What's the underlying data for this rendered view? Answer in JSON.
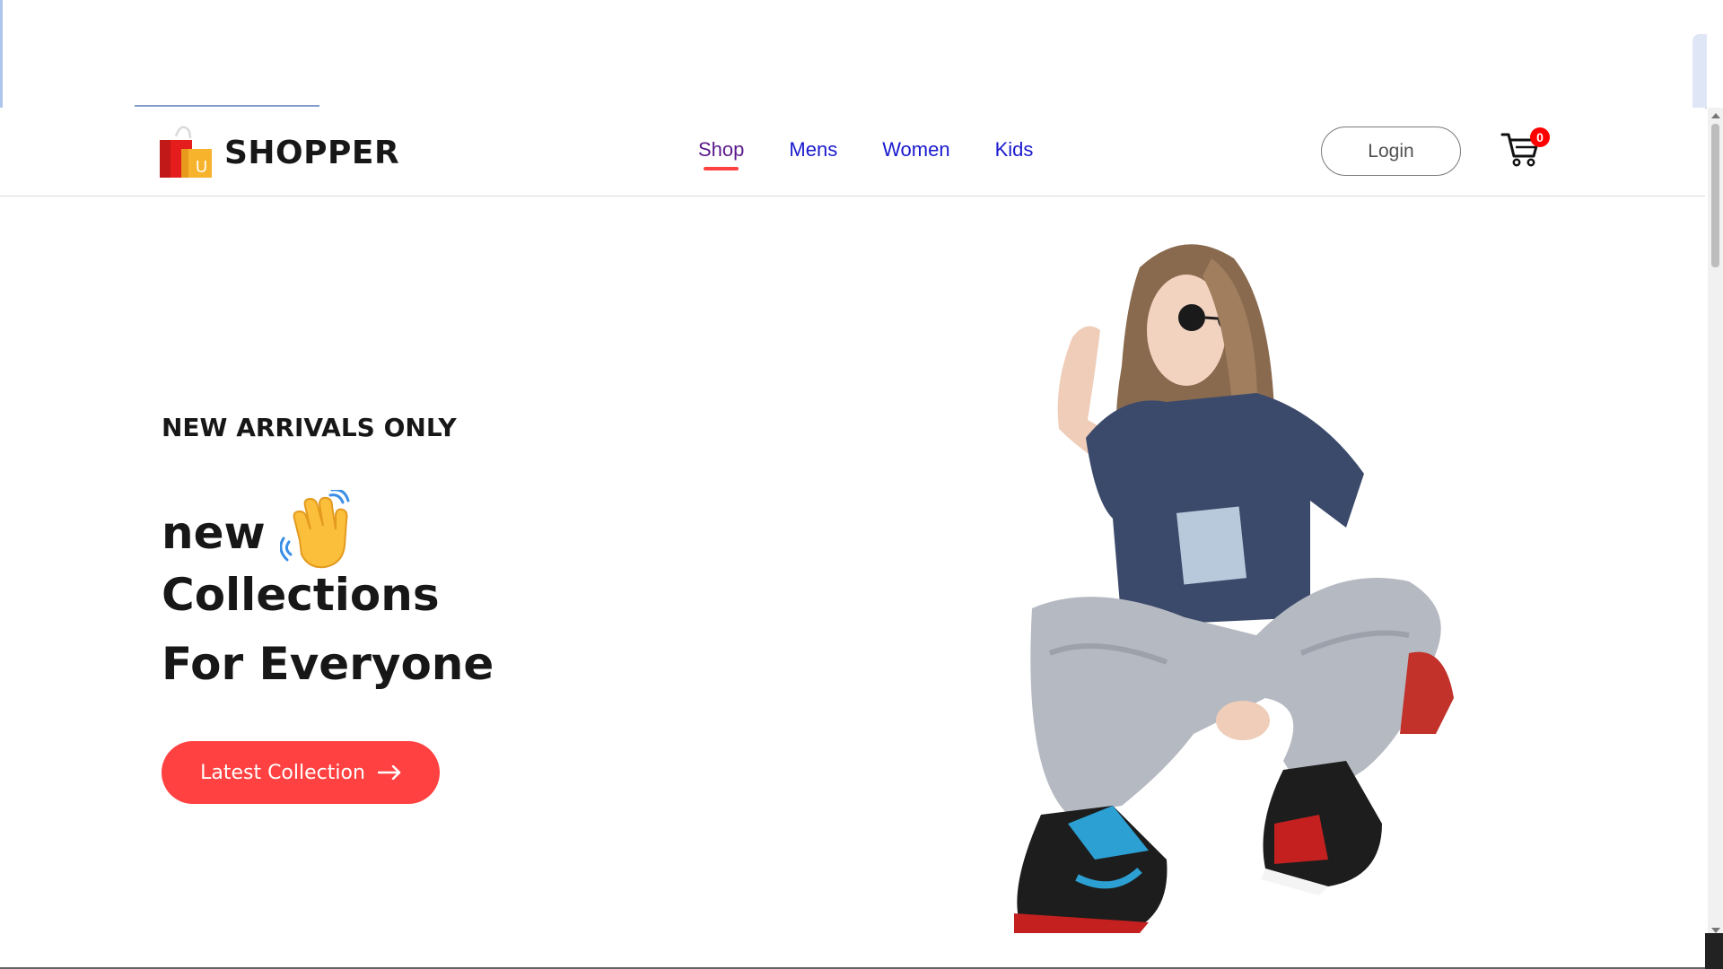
{
  "navbar": {
    "logo_text": "SHOPPER",
    "logo_badge": "U",
    "menu": [
      {
        "label": "Shop",
        "active": true
      },
      {
        "label": "Mens",
        "active": false
      },
      {
        "label": "Women",
        "active": false
      },
      {
        "label": "Kids",
        "active": false
      }
    ],
    "login_label": "Login",
    "cart_count": "0",
    "icons": {
      "logo": "shopping-bag-icon",
      "cart": "cart-icon"
    }
  },
  "hero": {
    "kicker": "NEW ARRIVALS ONLY",
    "line1": "new",
    "line2": "Collections",
    "line3": "For Everyone",
    "cta_label": "Latest Collection",
    "icons": {
      "hand": "waving-hand-icon",
      "arrow": "arrow-right-icon"
    }
  },
  "colors": {
    "accent": "#ff4141",
    "nav_link": "#1a1acf",
    "nav_active": "#5b1a8c",
    "text_dark": "#171717",
    "cart_badge": "#ff0000"
  }
}
